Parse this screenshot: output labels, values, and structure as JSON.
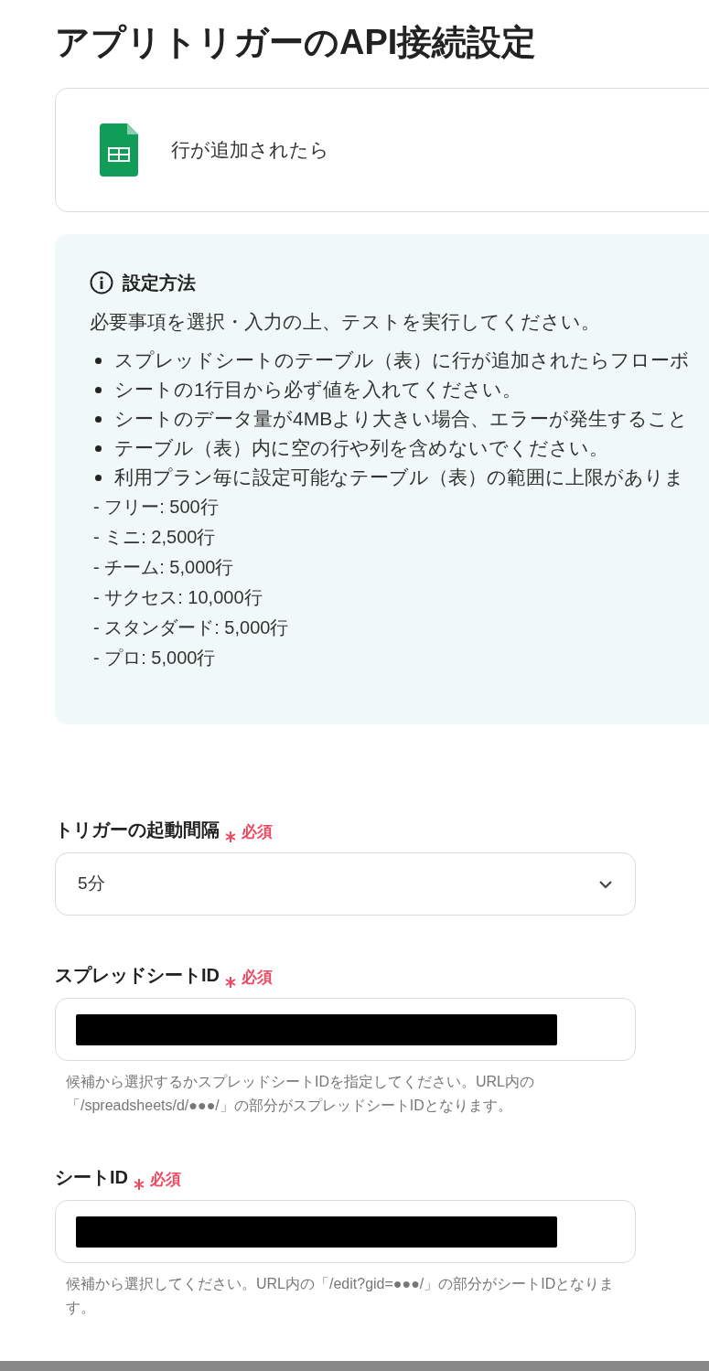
{
  "title": "アプリトリガーのAPI接続設定",
  "trigger_card": {
    "label": "行が追加されたら"
  },
  "info_box": {
    "heading": "設定方法",
    "intro": "必要事項を選択・入力の上、テストを実行してください。",
    "bullets": [
      "スプレッドシートのテーブル（表）に行が追加されたらフローボ",
      "シートの1行目から必ず値を入れてください。",
      "シートのデータ量が4MBより大きい場合、エラーが発生すること",
      "テーブル（表）内に空の行や列を含めないでください。",
      "利用プラン毎に設定可能なテーブル（表）の範囲に上限がありま"
    ],
    "plan_limits": [
      "- フリー: 500行",
      "- ミニ: 2,500行",
      "- チーム: 5,000行",
      "- サクセス: 10,000行",
      "- スタンダード: 5,000行",
      "- プロ: 5,000行"
    ]
  },
  "fields": [
    {
      "kind": "select",
      "label": "トリガーの起動間隔",
      "required_mark": "必須",
      "value": "5分"
    },
    {
      "kind": "input",
      "label": "スプレッドシートID",
      "required_mark": "必須",
      "redacted": true,
      "hint": "候補から選択するかスプレッドシートIDを指定してください。URL内の「/spreadsheets/d/●●●/」の部分がスプレッドシートIDとなります。"
    },
    {
      "kind": "input",
      "label": "シートID",
      "required_mark": "必須",
      "redacted": true,
      "hint": "候補から選択してください。URL内の「/edit?gid=●●●/」の部分がシートIDとなります。"
    }
  ]
}
